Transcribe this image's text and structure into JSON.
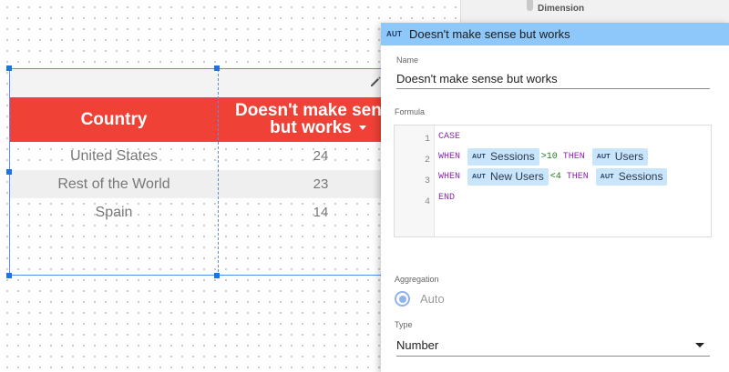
{
  "side_panel": {
    "section_label": "Dimension"
  },
  "table": {
    "headers": {
      "country": "Country",
      "dimension_line1": "Doesn't make sense",
      "dimension_line2": "but works"
    },
    "rows": [
      {
        "country": "United States",
        "value": "24"
      },
      {
        "country": "Rest of the World",
        "value": "23"
      },
      {
        "country": "Spain",
        "value": "14"
      }
    ],
    "header_color": "#ef4136"
  },
  "edit_panel": {
    "type_badge": "AUT",
    "title": "Doesn't make sense but works",
    "name_label": "Name",
    "name_value": "Doesn't make sense but works",
    "formula_label": "Formula",
    "line_numbers": [
      "1",
      "2",
      "3",
      "4"
    ],
    "formula": {
      "line1": {
        "kw": "CASE"
      },
      "line2": {
        "when": "WHEN",
        "badge": "AUT",
        "field": "Sessions",
        "cond": ">10",
        "then": "THEN",
        "badge2": "AUT",
        "result": "Users"
      },
      "line3": {
        "when": "WHEN",
        "badge": "AUT",
        "field": "New Users",
        "cond": "<4",
        "then": "THEN",
        "badge2": "AUT",
        "result": "Sessions"
      },
      "line4": {
        "kw": "END"
      }
    },
    "aggregation_label": "Aggregation",
    "aggregation_value": "Auto",
    "type_label": "Type",
    "type_value": "Number",
    "title_bar_color": "#8ec7f9"
  }
}
